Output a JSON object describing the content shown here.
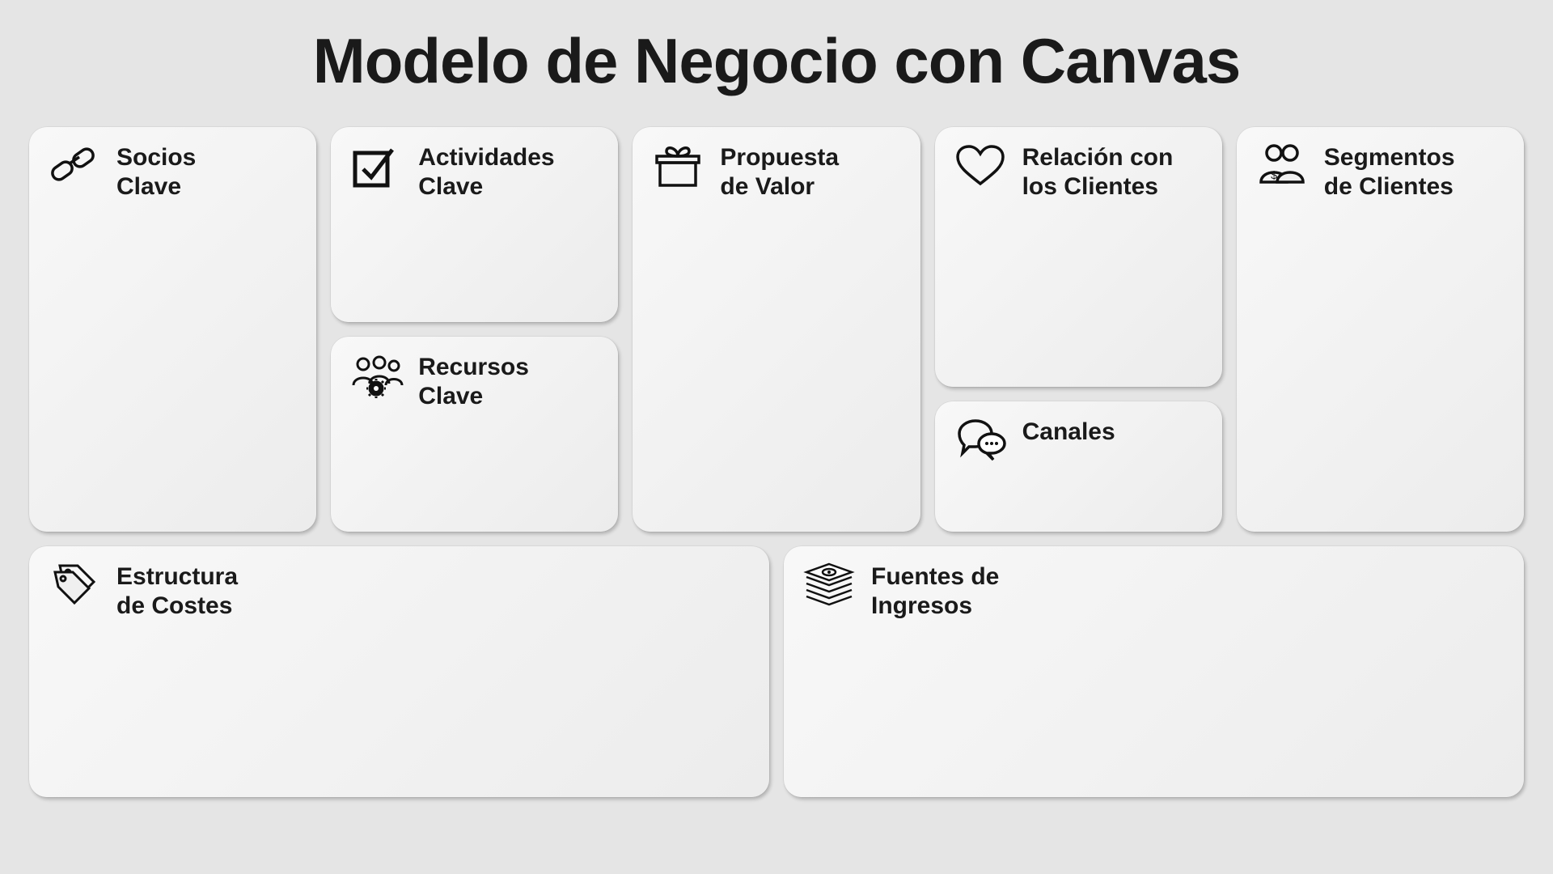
{
  "title": "Modelo de Negocio con Canvas",
  "blocks": {
    "partners": {
      "line1": "Socios",
      "line2": "Clave"
    },
    "activities": {
      "line1": "Actividades",
      "line2": "Clave"
    },
    "resources": {
      "line1": "Recursos",
      "line2": "Clave"
    },
    "value": {
      "line1": "Propuesta",
      "line2": "de Valor"
    },
    "relations": {
      "line1": "Relación con",
      "line2": "los Clientes"
    },
    "channels": {
      "line1": "Canales",
      "line2": ""
    },
    "segments": {
      "line1": "Segmentos",
      "line2": "de Clientes"
    },
    "costs": {
      "line1": "Estructura",
      "line2": "de Costes"
    },
    "revenue": {
      "line1": "Fuentes de",
      "line2": "Ingresos"
    }
  }
}
